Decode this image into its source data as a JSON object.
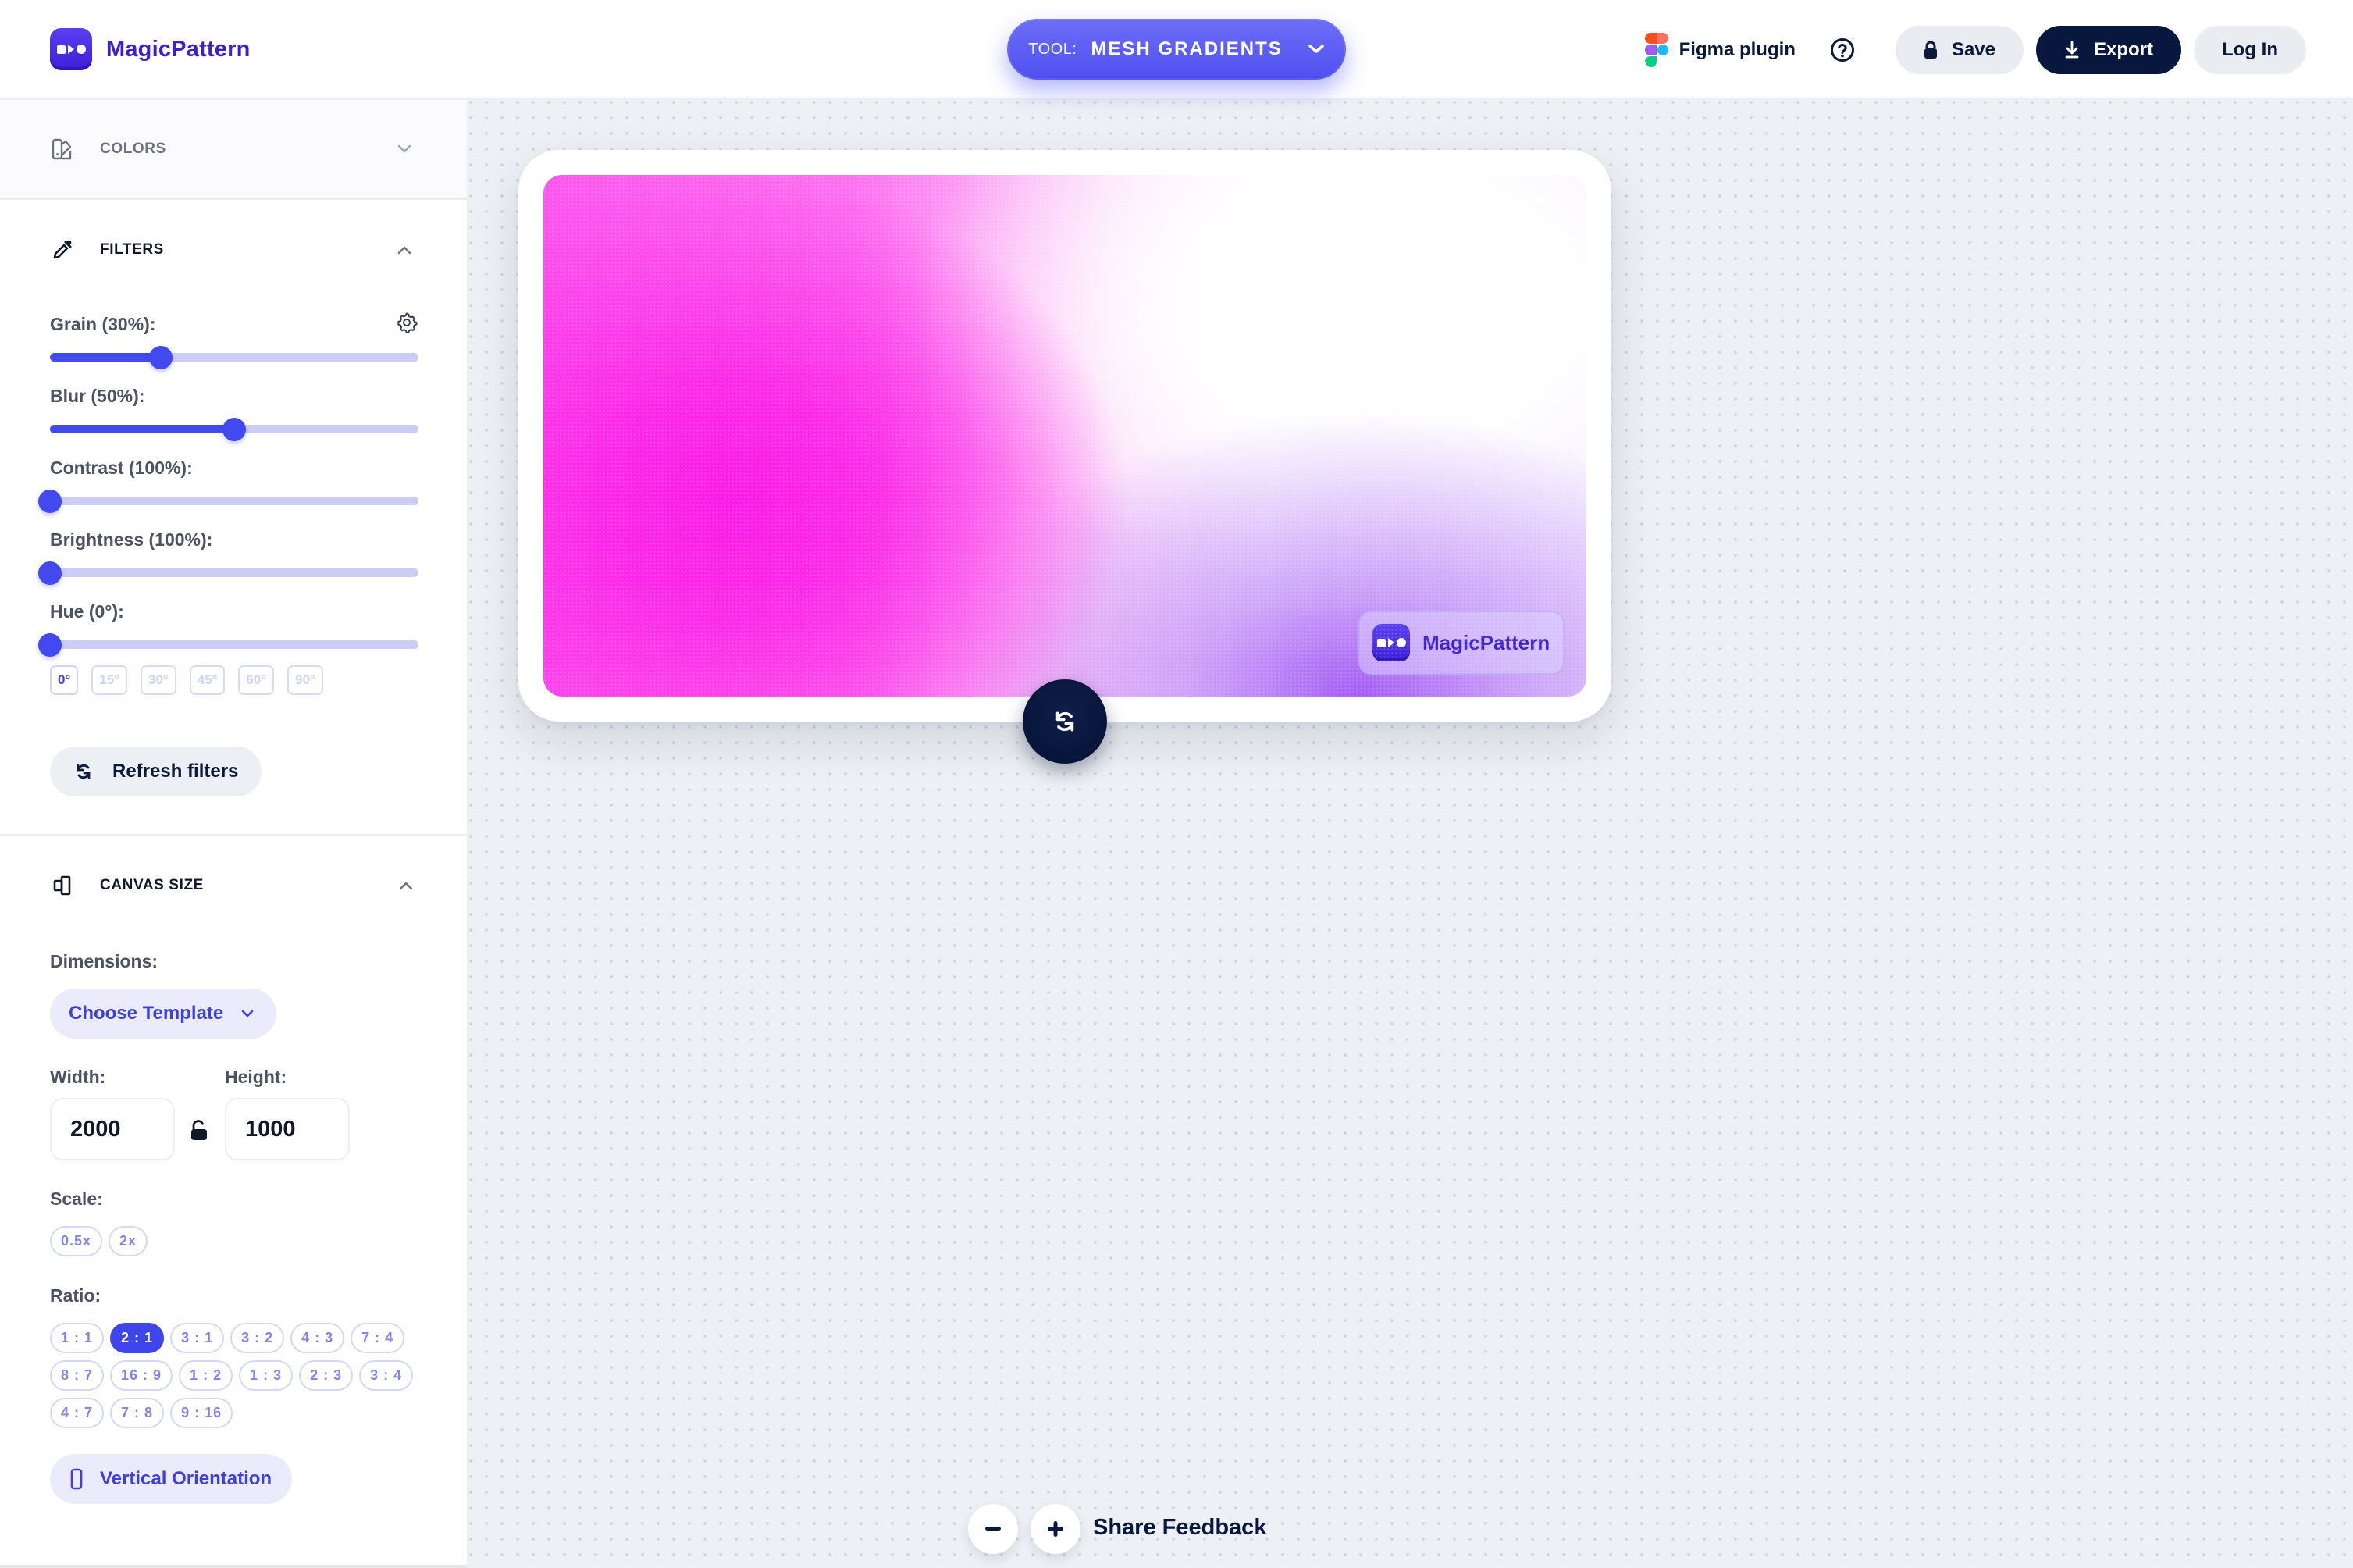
{
  "header": {
    "brand": "MagicPattern",
    "tool": {
      "prefix": "TOOL:",
      "name": "MESH GRADIENTS"
    },
    "figma_label": "Figma plugin",
    "save_label": "Save",
    "export_label": "Export",
    "login_label": "Log In"
  },
  "sidebar": {
    "colors": {
      "title": "COLORS",
      "expanded": false
    },
    "filters": {
      "title": "FILTERS",
      "expanded": true,
      "sliders": [
        {
          "label": "Grain (30%):",
          "value": 0.3
        },
        {
          "label": "Blur (50%):",
          "value": 0.5
        },
        {
          "label": "Contrast (100%):",
          "value": 0.0
        },
        {
          "label": "Brightness (100%):",
          "value": 0.0
        },
        {
          "label": "Hue (0°):",
          "value": 0.0
        }
      ],
      "hue_presets": [
        "0°",
        "15°",
        "30°",
        "45°",
        "60°",
        "90°"
      ],
      "hue_selected": "0°",
      "refresh_label": "Refresh filters"
    },
    "canvas_size": {
      "title": "CANVAS SIZE",
      "expanded": true,
      "dimensions_label": "Dimensions:",
      "template_label": "Choose Template",
      "width_label": "Width:",
      "height_label": "Height:",
      "width_value": "2000",
      "height_value": "1000",
      "scale_label": "Scale:",
      "scale_options": [
        "0.5x",
        "2x"
      ],
      "ratio_label": "Ratio:",
      "ratio_rows": [
        [
          "1 : 1",
          "2 : 1",
          "3 : 1",
          "3 : 2",
          "4 : 3",
          "7 : 4"
        ],
        [
          "8 : 7",
          "16 : 9",
          "1 : 2",
          "1 : 3",
          "2 : 3",
          "3 : 4"
        ],
        [
          "4 : 7",
          "7 : 8",
          "9 : 16"
        ]
      ],
      "ratio_selected": "2 : 1",
      "orientation_label": "Vertical Orientation"
    }
  },
  "canvas": {
    "watermark": "MagicPattern",
    "feedback_label": "Share Feedback",
    "colors": {
      "magenta": "#ff1ae6",
      "violet": "#a45cf5",
      "white": "#ffffff"
    }
  },
  "theme": {
    "accent": "#4249ef",
    "dark": "#07173d",
    "brand": "#3b1fd1"
  }
}
